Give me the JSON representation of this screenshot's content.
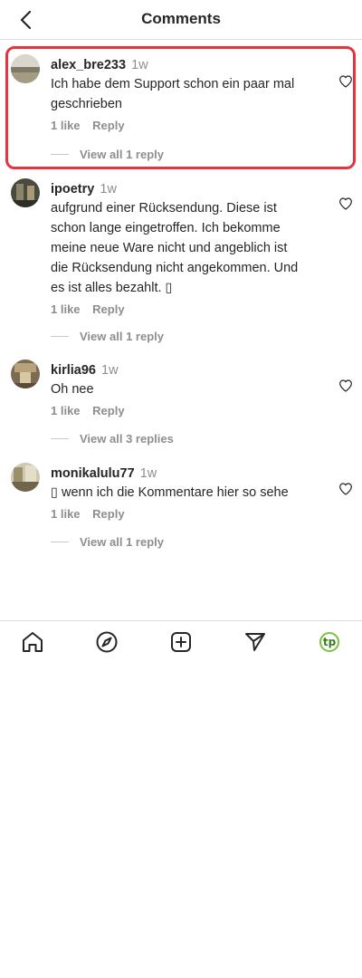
{
  "header": {
    "title": "Comments",
    "back_icon": "chevron-left-icon"
  },
  "comments": [
    {
      "username": "alex_bre233",
      "time": "1w",
      "text": "Ich habe dem Support schon ein paar mal geschrieben",
      "likes": "1 like",
      "reply_label": "Reply",
      "view_replies": "View all 1 reply"
    },
    {
      "username": "ipoetry",
      "time": "1w",
      "text": "aufgrund einer Rücksendung. Diese ist schon lange eingetroffen. Ich bekomme meine neue Ware nicht und angeblich ist die Rücksendung nicht angekommen. Und es ist alles bezahlt. ▯",
      "likes": "1 like",
      "reply_label": "Reply",
      "view_replies": "View all 1 reply"
    },
    {
      "username": "kirlia96",
      "time": "1w",
      "text": "Oh nee",
      "likes": "1 like",
      "reply_label": "Reply",
      "view_replies": "View all 3 replies"
    },
    {
      "username": "monikalulu77",
      "time": "1w",
      "text": "▯ wenn ich die Kommentare hier so sehe",
      "likes": "1 like",
      "reply_label": "Reply",
      "view_replies": "View all 1 reply"
    }
  ],
  "highlight_color": "#e5343f",
  "nav": {
    "items": [
      "home-icon",
      "explore-compass-icon",
      "create-plus-icon",
      "direct-send-icon",
      "profile-avatar-icon"
    ],
    "profile_badge": "tp",
    "profile_color": "#7bc142"
  }
}
